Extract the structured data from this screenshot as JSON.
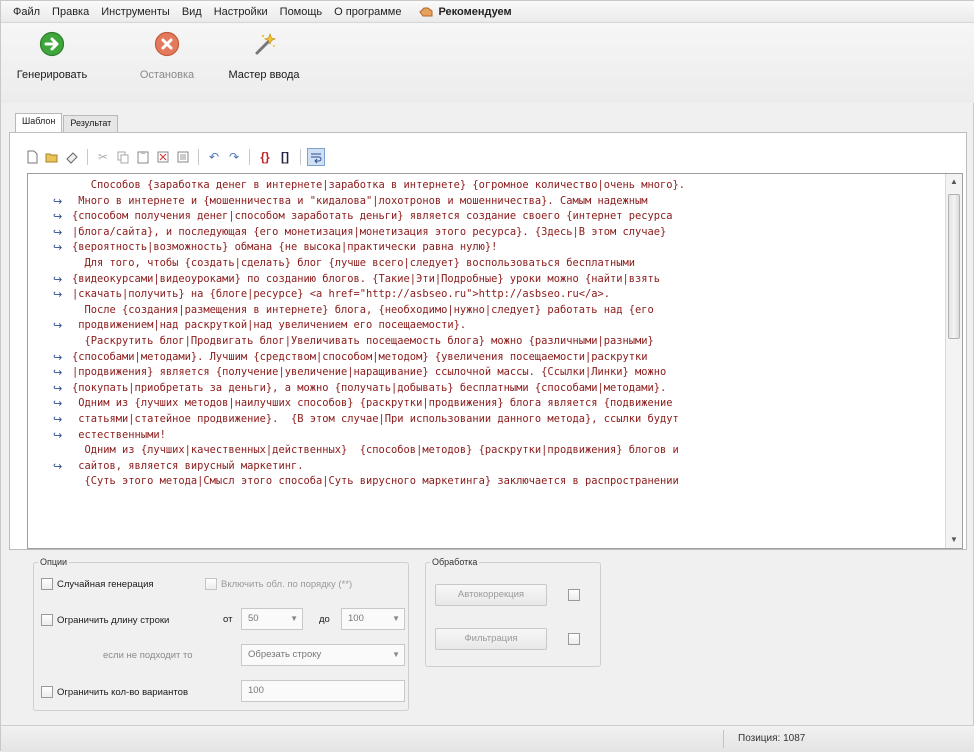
{
  "menu": {
    "items": [
      "Файл",
      "Правка",
      "Инструменты",
      "Вид",
      "Настройки",
      "Помощь",
      "О программе"
    ],
    "recommend": "Рекомендуем"
  },
  "toolbar": {
    "generate": "Генерировать",
    "stop": "Остановка",
    "wizard": "Мастер ввода"
  },
  "tabs": [
    "Шаблон",
    "Результат"
  ],
  "editor": {
    "lines": [
      {
        "wrap": false,
        "text": "   Способов {заработка денег в интернете|заработка в интернете} {огромное количество|очень много}."
      },
      {
        "wrap": true,
        "text": " Много в интернете и {мошенничества и \"кидалова\"|лохотронов и мошенничества}. Самым надежным"
      },
      {
        "wrap": true,
        "text": "{способом получения денег|способом заработать деньги} является создание своего {интернет ресурса"
      },
      {
        "wrap": true,
        "text": "|блога/сайта}, и последующая {его монетизация|монетизация этого ресурса}. {Здесь|В этом случае}"
      },
      {
        "wrap": true,
        "text": "{вероятность|возможность} обмана {не высока|практически равна нулю}!"
      },
      {
        "wrap": false,
        "text": "  Для того, чтобы {создать|сделать} блог {лучше всего|следует} воспользоваться бесплатными"
      },
      {
        "wrap": true,
        "text": "{видеокурсами|видеоуроками} по созданию блогов. {Такие|Эти|Подробные} уроки можно {найти|взять"
      },
      {
        "wrap": true,
        "text": "|скачать|получить} на {блоге|ресурсе} <a href=\"http://asbseo.ru\">http://asbseo.ru</a>."
      },
      {
        "wrap": false,
        "text": "  После {создания|размещения в интернете} блога, {необходимо|нужно|следует} работать над {его"
      },
      {
        "wrap": true,
        "text": " продвижением|над раскруткой|над увеличением его посещаемости}."
      },
      {
        "wrap": false,
        "text": "  {Раскрутить блог|Продвигать блог|Увеличивать посещаемость блога} можно {различными|разными}"
      },
      {
        "wrap": true,
        "text": "{способами|методами}. Лучшим {средством|способом|методом} {увеличения посещаемости|раскрутки"
      },
      {
        "wrap": true,
        "text": "|продвижения} является {получение|увеличение|наращивание} ссылочной массы. {Ссылки|Линки} можно"
      },
      {
        "wrap": true,
        "text": "{покупать|приобретать за деньги}, а можно {получать|добывать} бесплатными {способами|методами}."
      },
      {
        "wrap": true,
        "text": " Одним из {лучших методов|наилучших способов} {раскрутки|продвижения} блога является {подвижение"
      },
      {
        "wrap": true,
        "text": " статьями|статейное продвижение}.  {В этом случае|При использовании данного метода}, ссылки будут"
      },
      {
        "wrap": true,
        "text": " естественными!"
      },
      {
        "wrap": false,
        "text": "  Одним из {лучших|качественных|действенных}  {способов|методов} {раскрутки|продвижения} блогов и"
      },
      {
        "wrap": true,
        "text": " сайтов, является вирусный маркетинг."
      },
      {
        "wrap": false,
        "text": "  {Суть этого метода|Смысл этого способа|Суть вирусного маркетинга} заключается в распространении"
      }
    ]
  },
  "options": {
    "legend": "Опции",
    "random_generation": "Случайная генерация",
    "include_in_order": "Включить обл. по порядку (**)",
    "limit_line_length": "Ограничить длину строки",
    "from_label": "от",
    "from_value": "50",
    "to_label": "до",
    "to_value": "100",
    "if_not_fit_label": "если не подходит то",
    "if_not_fit_value": "Обрезать строку",
    "limit_variants": "Ограничить кол-во вариантов",
    "variants_value": "100"
  },
  "processing": {
    "legend": "Обработка",
    "autocorrect": "Автокоррекция",
    "filter": "Фильтрация"
  },
  "status": {
    "position": "Позиция: 1087"
  }
}
